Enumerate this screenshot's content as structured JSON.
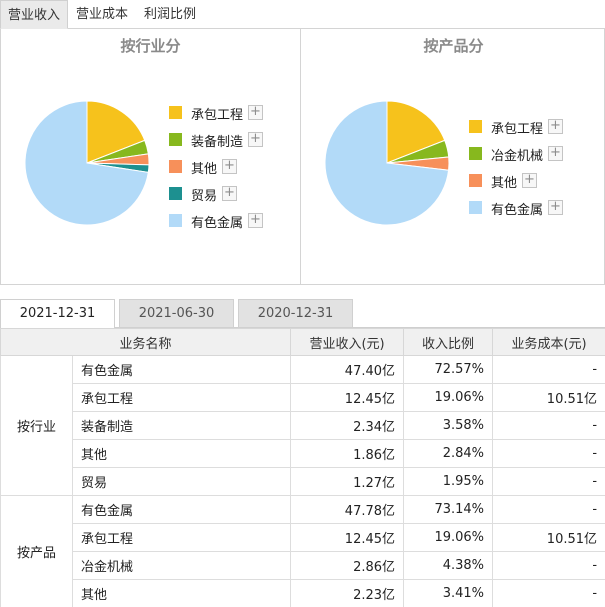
{
  "top_tabs": [
    {
      "label": "营业收入",
      "active": true
    },
    {
      "label": "营业成本",
      "active": false
    },
    {
      "label": "利润比例",
      "active": false
    }
  ],
  "chart_data": [
    {
      "type": "pie",
      "title": "按行业分",
      "categories": [
        "承包工程",
        "装备制造",
        "其他",
        "贸易",
        "有色金属"
      ],
      "values": [
        19.06,
        3.58,
        2.84,
        1.95,
        72.57
      ],
      "colors": [
        "#f6c21c",
        "#87b81e",
        "#f7905a",
        "#1d9090",
        "#b2daf8"
      ],
      "legend_position": "right"
    },
    {
      "type": "pie",
      "title": "按产品分",
      "categories": [
        "承包工程",
        "冶金机械",
        "其他",
        "有色金属"
      ],
      "values": [
        19.06,
        4.38,
        3.41,
        73.14
      ],
      "colors": [
        "#f6c21c",
        "#87b81e",
        "#f7905a",
        "#b2daf8"
      ],
      "legend_position": "right"
    }
  ],
  "legend_plus": "+",
  "date_tabs": [
    {
      "label": "2021-12-31",
      "active": true
    },
    {
      "label": "2021-06-30",
      "active": false
    },
    {
      "label": "2020-12-31",
      "active": false
    }
  ],
  "table": {
    "headers": [
      "业务名称",
      "营业收入(元)",
      "收入比例",
      "业务成本(元)"
    ],
    "groups": [
      {
        "label": "按行业",
        "rows": [
          [
            "有色金属",
            "47.40亿",
            "72.57%",
            "-"
          ],
          [
            "承包工程",
            "12.45亿",
            "19.06%",
            "10.51亿"
          ],
          [
            "装备制造",
            "2.34亿",
            "3.58%",
            "-"
          ],
          [
            "其他",
            "1.86亿",
            "2.84%",
            "-"
          ],
          [
            "贸易",
            "1.27亿",
            "1.95%",
            "-"
          ]
        ]
      },
      {
        "label": "按产品",
        "rows": [
          [
            "有色金属",
            "47.78亿",
            "73.14%",
            "-"
          ],
          [
            "承包工程",
            "12.45亿",
            "19.06%",
            "10.51亿"
          ],
          [
            "冶金机械",
            "2.86亿",
            "4.38%",
            "-"
          ],
          [
            "其他",
            "2.23亿",
            "3.41%",
            "-"
          ]
        ]
      }
    ]
  }
}
